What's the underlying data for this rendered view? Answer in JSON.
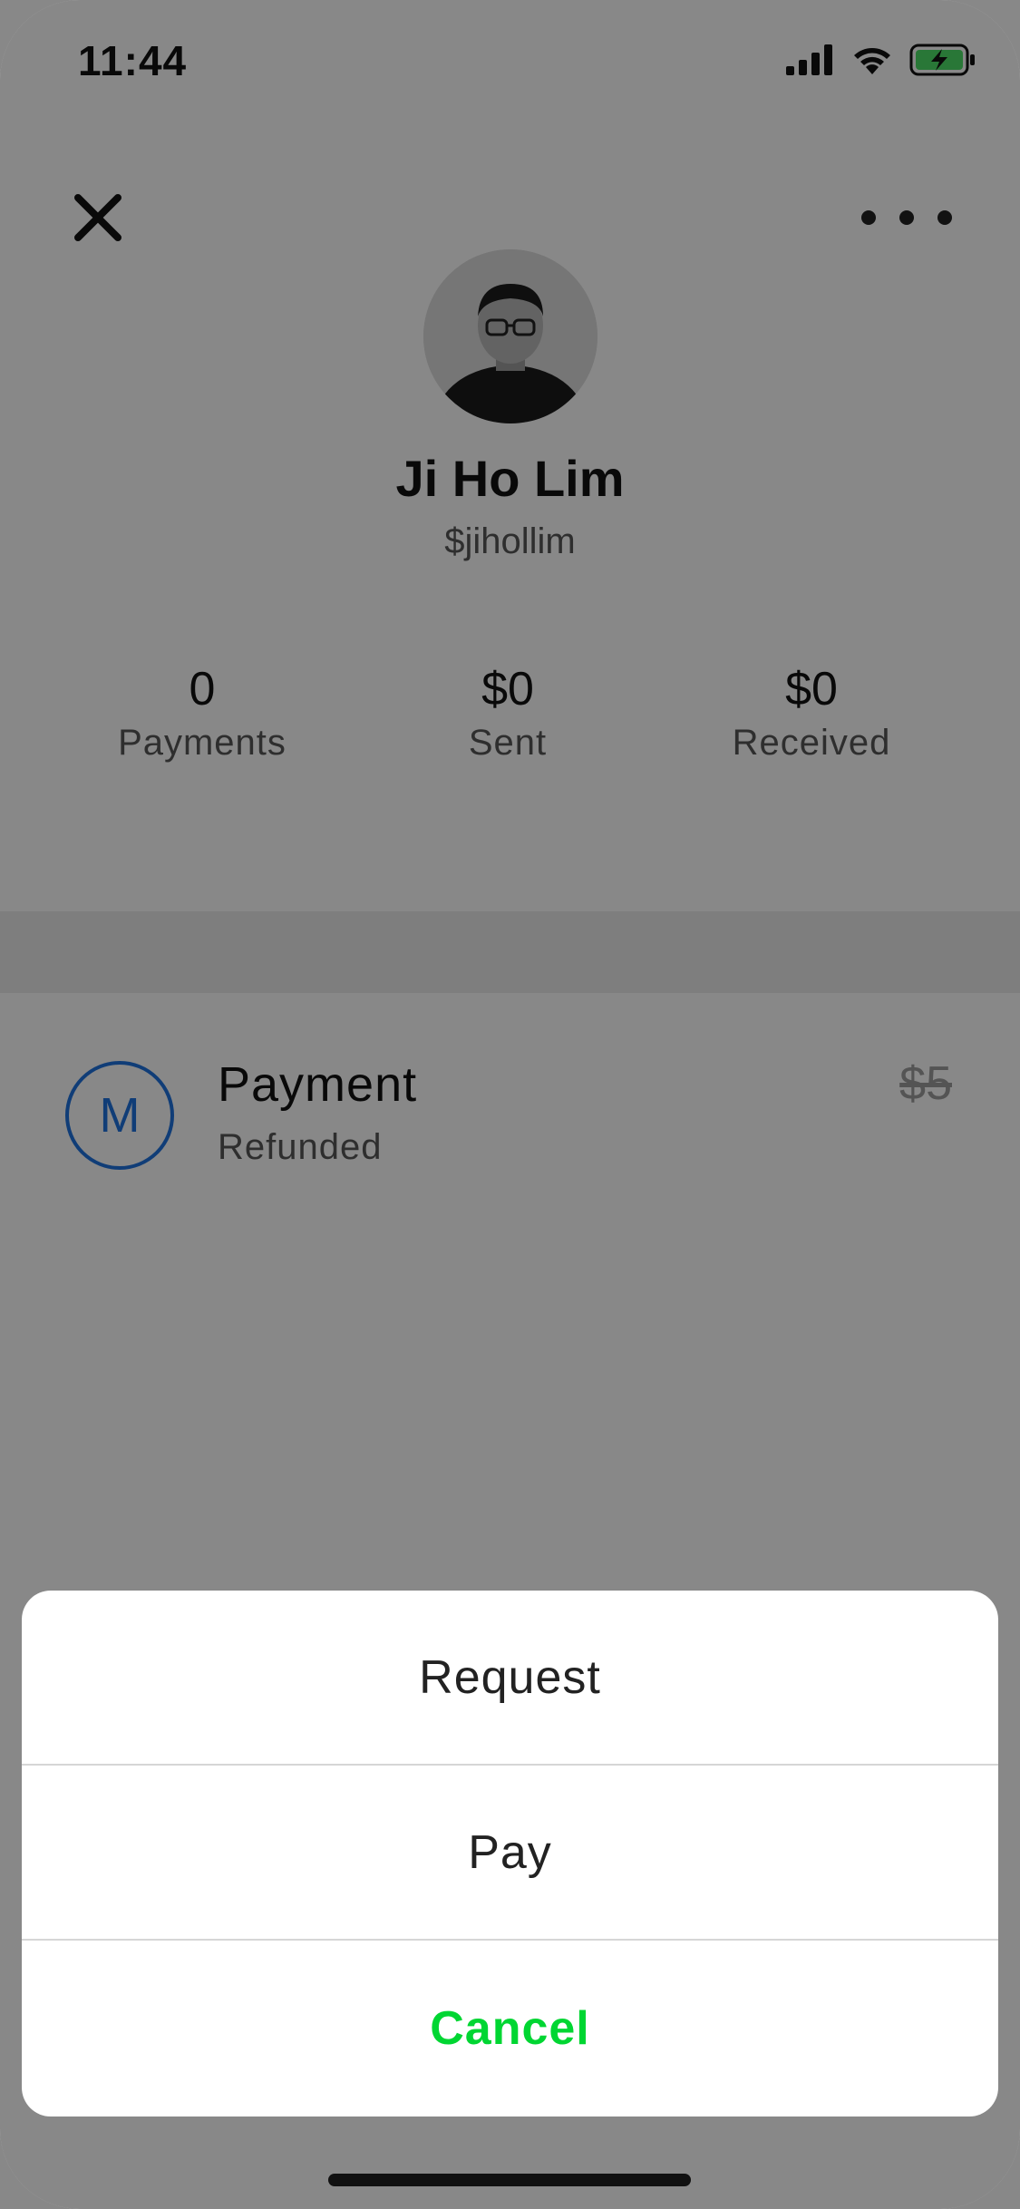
{
  "status_bar": {
    "time": "11:44"
  },
  "profile": {
    "name": "Ji Ho Lim",
    "handle": "$jihollim"
  },
  "stats": [
    {
      "value": "0",
      "label": "Payments"
    },
    {
      "value": "$0",
      "label": "Sent"
    },
    {
      "value": "$0",
      "label": "Received"
    }
  ],
  "transaction": {
    "initial": "M",
    "title": "Payment",
    "status": "Refunded",
    "amount": "$5"
  },
  "action_sheet": {
    "request": "Request",
    "pay": "Pay",
    "cancel": "Cancel"
  },
  "colors": {
    "accent_green": "#00d632",
    "circle_blue": "#1e6fd9",
    "battery_green": "#4cd964"
  }
}
